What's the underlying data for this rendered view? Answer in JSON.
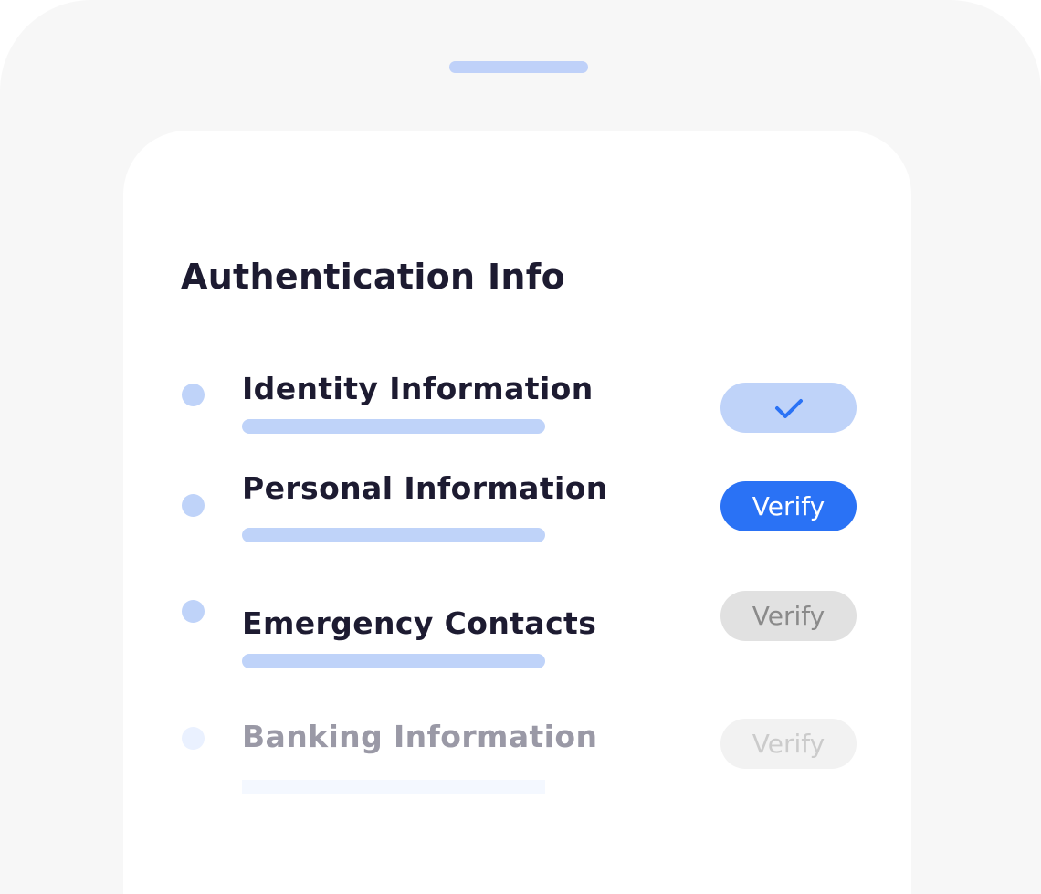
{
  "screen": {
    "title": "Authentication Info"
  },
  "items": [
    {
      "label": "Identity Information",
      "status": "completed",
      "icon": "checkmark-icon"
    },
    {
      "label": "Personal Information",
      "status": "active",
      "action": "Verify"
    },
    {
      "label": "Emergency Contacts",
      "status": "pending",
      "action": "Verify"
    },
    {
      "label": "Banking Information",
      "status": "pending",
      "action": "Verify"
    }
  ],
  "colors": {
    "accent": "#2a72f5",
    "light_accent": "#bfd3f9",
    "title_text": "#1d1b31",
    "device_frame": "#f7f7f7"
  }
}
